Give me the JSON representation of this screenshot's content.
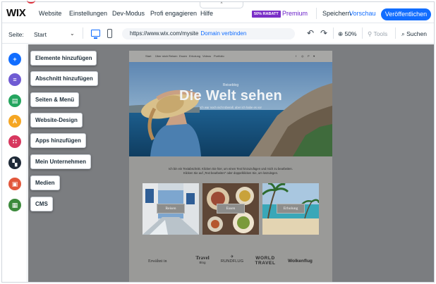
{
  "topbar": {
    "logo": "WIX",
    "menu": [
      "Website",
      "Einstellungen",
      "Dev-Modus",
      "Profi engagieren",
      "Hilfe"
    ],
    "collapse_glyph": "^",
    "sale_badge": "50% RABATT",
    "premium": "Premium",
    "save": "Speichern",
    "preview": "Vorschau",
    "publish": "Veröffentlichen"
  },
  "subbar": {
    "page_label": "Seite:",
    "page_value": "Start",
    "url": "https://www.wix.com/mysite",
    "domain_link": "Domain verbinden",
    "zoom": "50%",
    "tools": "Tools",
    "search": "Suchen"
  },
  "rail_icons": [
    {
      "name": "add-elements-icon",
      "color": "#116dff",
      "glyph": "+"
    },
    {
      "name": "add-section-icon",
      "color": "#6f5bd3",
      "glyph": "≡"
    },
    {
      "name": "pages-menu-icon",
      "color": "#25a55f",
      "glyph": "▤"
    },
    {
      "name": "site-design-icon",
      "color": "#f5a623",
      "glyph": "A"
    },
    {
      "name": "add-apps-icon",
      "color": "#d7385f",
      "glyph": "∷"
    },
    {
      "name": "business-icon",
      "color": "#1f2a38",
      "glyph": "▚"
    },
    {
      "name": "media-icon",
      "color": "#e2573b",
      "glyph": "▣"
    },
    {
      "name": "cms-icon",
      "color": "#3c8a3c",
      "glyph": "▦"
    }
  ],
  "panel_buttons": [
    "Elemente hinzufügen",
    "Abschnitt hinzufügen",
    "Seiten & Menü",
    "Website-Design",
    "Apps hinzufügen",
    "Mein Unternehmen",
    "Medien",
    "CMS"
  ],
  "site": {
    "nav": [
      "Start",
      "Über mich",
      "Reisen",
      "Essen",
      "Erholung",
      "Videos",
      "Portfolio"
    ],
    "social": [
      "f",
      "◎",
      "P",
      "♥"
    ],
    "hero_tag": "Reiseblog",
    "hero_title": "Die Welt sehen",
    "hero_sub": "Ich war noch nicht überall, aber ich habe es vor",
    "intro_line1": "Ich bin ein Textabschnitt. Klicken Sie hier, um einen Text hinzuzufügen und mich zu bearbeiten.",
    "intro_line2": "Klicken Sie auf „Text bearbeiten\" oder doppelklicken Sie, um loszulegen.",
    "cards": [
      "Reisen",
      "Essen",
      "Erholung"
    ],
    "featured": "Erwähnt in",
    "logos": {
      "travel_top": "Travel",
      "travel_bottom": "Blog",
      "rundflug": "RUNDFLUG",
      "world_top": "WORLD",
      "world_bottom": "TRAVEL",
      "wolkenflug": "Wolkenflug"
    }
  }
}
